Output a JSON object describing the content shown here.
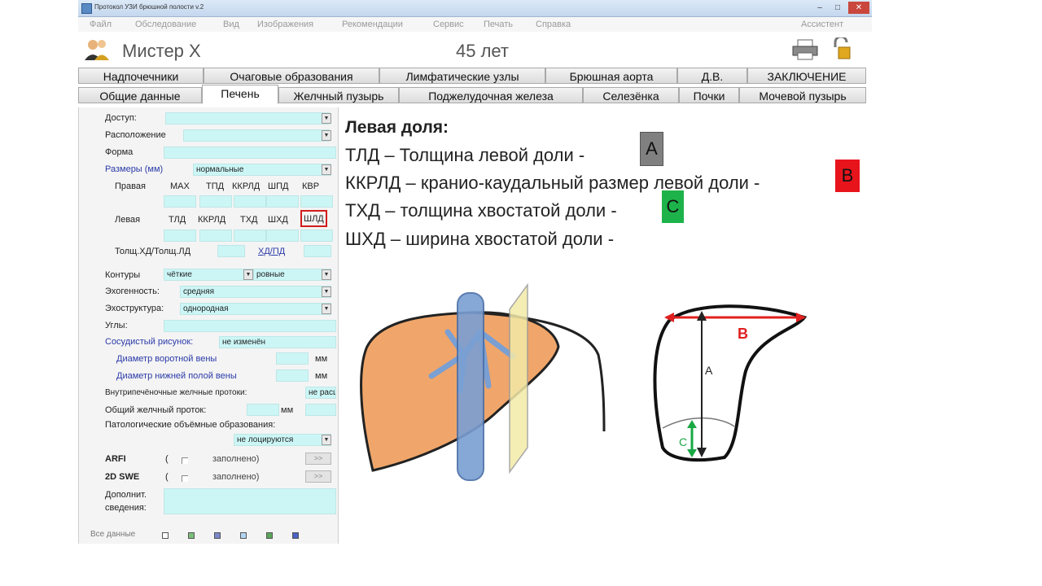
{
  "window": {
    "title": "Протокол УЗИ брюшной полости v.2",
    "controls": {
      "minimize": "–",
      "maximize": "□",
      "close": "✕"
    }
  },
  "menu": {
    "items": [
      "Файл",
      "Обследование",
      "Вид",
      "Изображения",
      "Рекомендации",
      "Сервис",
      "Печать",
      "Справка"
    ],
    "assistant": "Ассистент"
  },
  "patient": {
    "name": "Мистер Х",
    "age": "45 лет"
  },
  "tabs": {
    "row1": [
      "Надпочечники",
      "Очаговые образования",
      "Лимфатические узлы",
      "Брюшная аорта",
      "Д.В.",
      "ЗАКЛЮЧЕНИЕ"
    ],
    "row2": [
      "Общие данные",
      "Печень",
      "Желчный пузырь",
      "Поджелудочная железа",
      "Селезёнка",
      "Почки",
      "Мочевой пузырь"
    ]
  },
  "form": {
    "access_label": "Доступ:",
    "location_label": "Расположение",
    "shape_label": "Форма",
    "sizes_label": "Размеры (мм)",
    "sizes_value": "нормальные",
    "right_label": "Правая",
    "right_headers": [
      "MAX",
      "ТПД",
      "ККРЛД",
      "ШПД",
      "КВР"
    ],
    "left_label": "Левая",
    "left_headers": [
      "ТЛД",
      "ККРЛД",
      "ТХД",
      "ШХД",
      "ШЛД"
    ],
    "ratio_label": "Толщ.ХД/Толщ.ЛД",
    "ratio2_label": "ХД/ПД",
    "contours_label": "Контуры",
    "contours_value1": "чёткие",
    "contours_value2": "ровные",
    "echogenicity_label": "Эхогенность:",
    "echogenicity_value": "средняя",
    "echostructure_label": "Эхоструктура:",
    "echostructure_value": "однородная",
    "angles_label": "Углы:",
    "vascular_label": "Сосудистый рисунок:",
    "vascular_value": "не изменён",
    "portal_label": "Диаметр воротной вены",
    "ivc_label": "Диаметр нижней полой вены",
    "unit_mm": "мм",
    "intrahepatic_label": "Внутрипечёночные желчные протоки:",
    "intrahepatic_value": "не расширены",
    "common_duct_label": "Общий желчный проток:",
    "pathology_label": "Патологические объёмные образования:",
    "pathology_value": "не лоцируются",
    "arfi_label": "ARFI",
    "swe_label": "2D SWE",
    "paren_open": "(",
    "filled_label": "заполнено)",
    "btn_label": ">>",
    "extra_label_1": "Дополнит.",
    "extra_label_2": "сведения:",
    "all_data_label": "Все данные"
  },
  "description": {
    "heading": "Левая  доля:",
    "line1": "ТЛД – Толщина левой доли -",
    "line2": "ККРЛД – кранио-каудальный размер левой доли -",
    "line3": "ТХД – толщина хвостатой доли -",
    "line4": "ШХД – ширина хвостатой доли  -",
    "badge_a": "A",
    "badge_b": "B",
    "badge_c": "C",
    "colors": {
      "a": "#808080",
      "b": "#e8141c",
      "c": "#1db34a"
    }
  },
  "diagram": {
    "label_a": "A",
    "label_b": "B",
    "label_c": "C",
    "colors": {
      "liver": "#f0a66a",
      "vessel": "#7a9fd3",
      "plane": "#f3eaa8",
      "arrow_b": "#e02020",
      "arrow_c": "#1aa845"
    }
  }
}
